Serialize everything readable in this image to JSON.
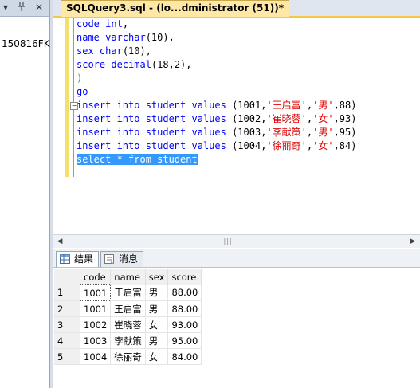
{
  "left_panel": {
    "item_text": "150816FK",
    "header_icons": [
      "chevron-down-icon",
      "pin-icon",
      "close-icon"
    ]
  },
  "document": {
    "tab_title": "SQLQuery3.sql - (lo...dministrator (51))*",
    "code_lines": [
      {
        "segments": [
          {
            "t": "code ",
            "c": "kw"
          },
          {
            "t": "int",
            "c": "kw"
          },
          {
            "t": ",",
            "c": "plain"
          }
        ]
      },
      {
        "segments": [
          {
            "t": "name ",
            "c": "kw"
          },
          {
            "t": "varchar",
            "c": "kw"
          },
          {
            "t": "(10),",
            "c": "plain"
          }
        ]
      },
      {
        "segments": [
          {
            "t": "sex ",
            "c": "kw"
          },
          {
            "t": "char",
            "c": "kw"
          },
          {
            "t": "(10),",
            "c": "plain"
          }
        ]
      },
      {
        "segments": [
          {
            "t": "score ",
            "c": "kw"
          },
          {
            "t": "decimal",
            "c": "kw"
          },
          {
            "t": "(18,2),",
            "c": "plain"
          }
        ]
      },
      {
        "segments": [
          {
            "t": ")",
            "c": "cm"
          }
        ]
      },
      {
        "segments": [
          {
            "t": "go",
            "c": "kw"
          }
        ]
      },
      {
        "segments": [
          {
            "t": "insert into student values ",
            "c": "kw"
          },
          {
            "t": "(1001,",
            "c": "plain"
          },
          {
            "t": "'王启富'",
            "c": "str"
          },
          {
            "t": ",",
            "c": "plain"
          },
          {
            "t": "'男'",
            "c": "str"
          },
          {
            "t": ",88)",
            "c": "plain"
          }
        ]
      },
      {
        "segments": [
          {
            "t": "insert into student values ",
            "c": "kw"
          },
          {
            "t": "(1002,",
            "c": "plain"
          },
          {
            "t": "'崔晓蓉'",
            "c": "str"
          },
          {
            "t": ",",
            "c": "plain"
          },
          {
            "t": "'女'",
            "c": "str"
          },
          {
            "t": ",93)",
            "c": "plain"
          }
        ]
      },
      {
        "segments": [
          {
            "t": "insert into student values ",
            "c": "kw"
          },
          {
            "t": "(1003,",
            "c": "plain"
          },
          {
            "t": "'李献策'",
            "c": "str"
          },
          {
            "t": ",",
            "c": "plain"
          },
          {
            "t": "'男'",
            "c": "str"
          },
          {
            "t": ",95)",
            "c": "plain"
          }
        ]
      },
      {
        "segments": [
          {
            "t": "insert into student values ",
            "c": "kw"
          },
          {
            "t": "(1004,",
            "c": "plain"
          },
          {
            "t": "'徐丽奇'",
            "c": "str"
          },
          {
            "t": ",",
            "c": "plain"
          },
          {
            "t": "'女'",
            "c": "str"
          },
          {
            "t": ",84)",
            "c": "plain"
          }
        ]
      },
      {
        "segments": [
          {
            "t": "select * from student",
            "c": "sel"
          }
        ]
      }
    ]
  },
  "results": {
    "tab_results_label": "结果",
    "tab_messages_label": "消息",
    "columns": [
      "code",
      "name",
      "sex",
      "score"
    ],
    "rows": [
      {
        "num": "1",
        "code": "1001",
        "name": "王启富",
        "sex": "男",
        "score": "88.00"
      },
      {
        "num": "2",
        "code": "1001",
        "name": "王启富",
        "sex": "男",
        "score": "88.00"
      },
      {
        "num": "3",
        "code": "1002",
        "name": "崔晓蓉",
        "sex": "女",
        "score": "93.00"
      },
      {
        "num": "4",
        "code": "1003",
        "name": "李献策",
        "sex": "男",
        "score": "95.00"
      },
      {
        "num": "5",
        "code": "1004",
        "name": "徐丽奇",
        "sex": "女",
        "score": "84.00"
      }
    ]
  },
  "colors": {
    "keyword": "#0000ff",
    "string": "#e00000",
    "selection": "#3399ff",
    "tab_active": "#ffe8a6",
    "gutter_modified": "#f3e06a"
  }
}
